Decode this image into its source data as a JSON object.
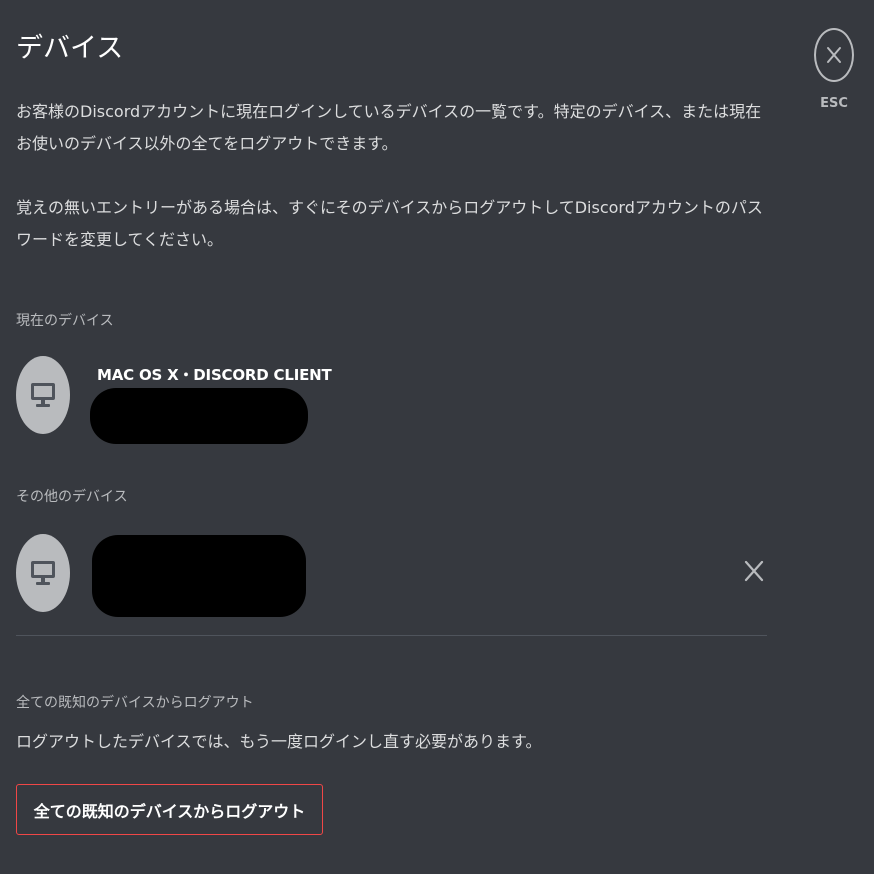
{
  "header": {
    "title": "デバイス",
    "description_1": "お客様のDiscordアカウントに現在ログインしているデバイスの一覧です。特定のデバイス、または現在お使いのデバイス以外の全てをログアウトできます。",
    "description_2": "覚えの無いエントリーがある場合は、すぐにそのデバイスからログアウトしてDiscordアカウントのパスワードを変更してください。"
  },
  "close": {
    "icon": "close-icon",
    "esc_label": "ESC"
  },
  "current_section": {
    "label": "現在のデバイス",
    "device": {
      "icon": "monitor-icon",
      "name": "MAC OS X・DISCORD CLIENT"
    }
  },
  "other_section": {
    "label": "その他のデバイス",
    "devices": [
      {
        "icon": "monitor-icon",
        "logout_icon": "close-icon"
      }
    ]
  },
  "logout_all": {
    "label": "全ての既知のデバイスからログアウト",
    "description": "ログアウトしたデバイスでは、もう一度ログインし直す必要があります。",
    "button_label": "全ての既知のデバイスからログアウト"
  },
  "colors": {
    "background": "#36393f",
    "text": "#dcddde",
    "muted": "#b9bbbe",
    "danger": "#f04747",
    "redaction": "#000000"
  }
}
